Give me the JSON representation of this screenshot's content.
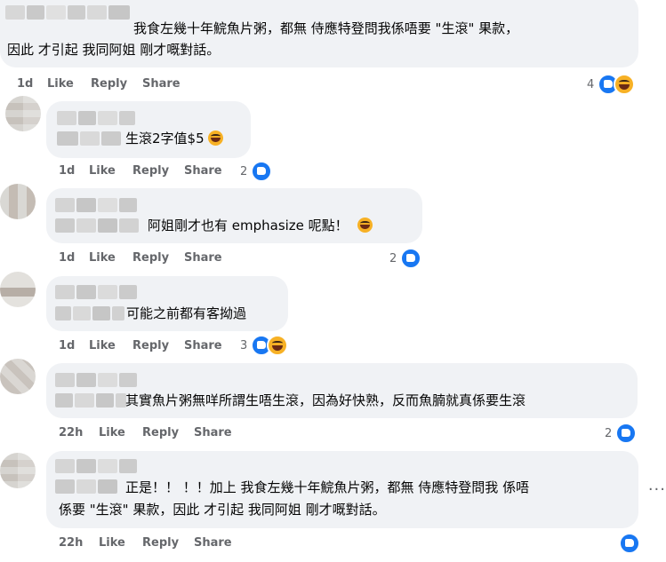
{
  "colors": {
    "bubble": "#f0f2f5",
    "meta_text": "#65676b",
    "like_blue": "#1877f2",
    "haha_yellow": "#f7b125"
  },
  "comments": [
    {
      "line1": "我食左幾十年鯇魚片粥，都無 侍應特登問我係唔要 \"生滾\" 果款，",
      "line2": "因此 才引起 我同阿姐 剛才嘅對話。",
      "time": "1d",
      "like": "Like",
      "reply": "Reply",
      "share": "Share",
      "reaction_count": "4",
      "reaction_icons": [
        "like-icon",
        "haha-icon"
      ]
    },
    {
      "line1": "生滾2字值$5",
      "emoji": "laughing-emoji",
      "time": "1d",
      "like": "Like",
      "reply": "Reply",
      "share": "Share",
      "reaction_count": "2",
      "reaction_icons": [
        "like-icon"
      ]
    },
    {
      "line1": "阿姐剛才也有 emphasize 呢點！",
      "emoji": "laughing-emoji",
      "time": "1d",
      "like": "Like",
      "reply": "Reply",
      "share": "Share",
      "reaction_count": "2",
      "reaction_icons": [
        "like-icon"
      ]
    },
    {
      "line1": "可能之前都有客拗過",
      "time": "1d",
      "like": "Like",
      "reply": "Reply",
      "share": "Share",
      "reaction_count": "3",
      "reaction_icons": [
        "like-icon",
        "haha-icon"
      ]
    },
    {
      "line1": "其實魚片粥無咩所謂生唔生滾，因為好快熟，反而魚腩就真係要生滾",
      "time": "22h",
      "like": "Like",
      "reply": "Reply",
      "share": "Share",
      "reaction_count": "2",
      "reaction_icons": [
        "like-icon"
      ]
    },
    {
      "line1": "正是！！ ！！加上 我食左幾十年鯇魚片粥，都無 侍應特登問我 係唔",
      "line2": "係要 \"生滾\" 果款，因此 才引起 我同阿姐 剛才嘅對話。",
      "time": "22h",
      "like": "Like",
      "reply": "Reply",
      "share": "Share",
      "reaction_count": "",
      "reaction_icons": [
        "like-icon"
      ]
    }
  ],
  "more_options": "···"
}
